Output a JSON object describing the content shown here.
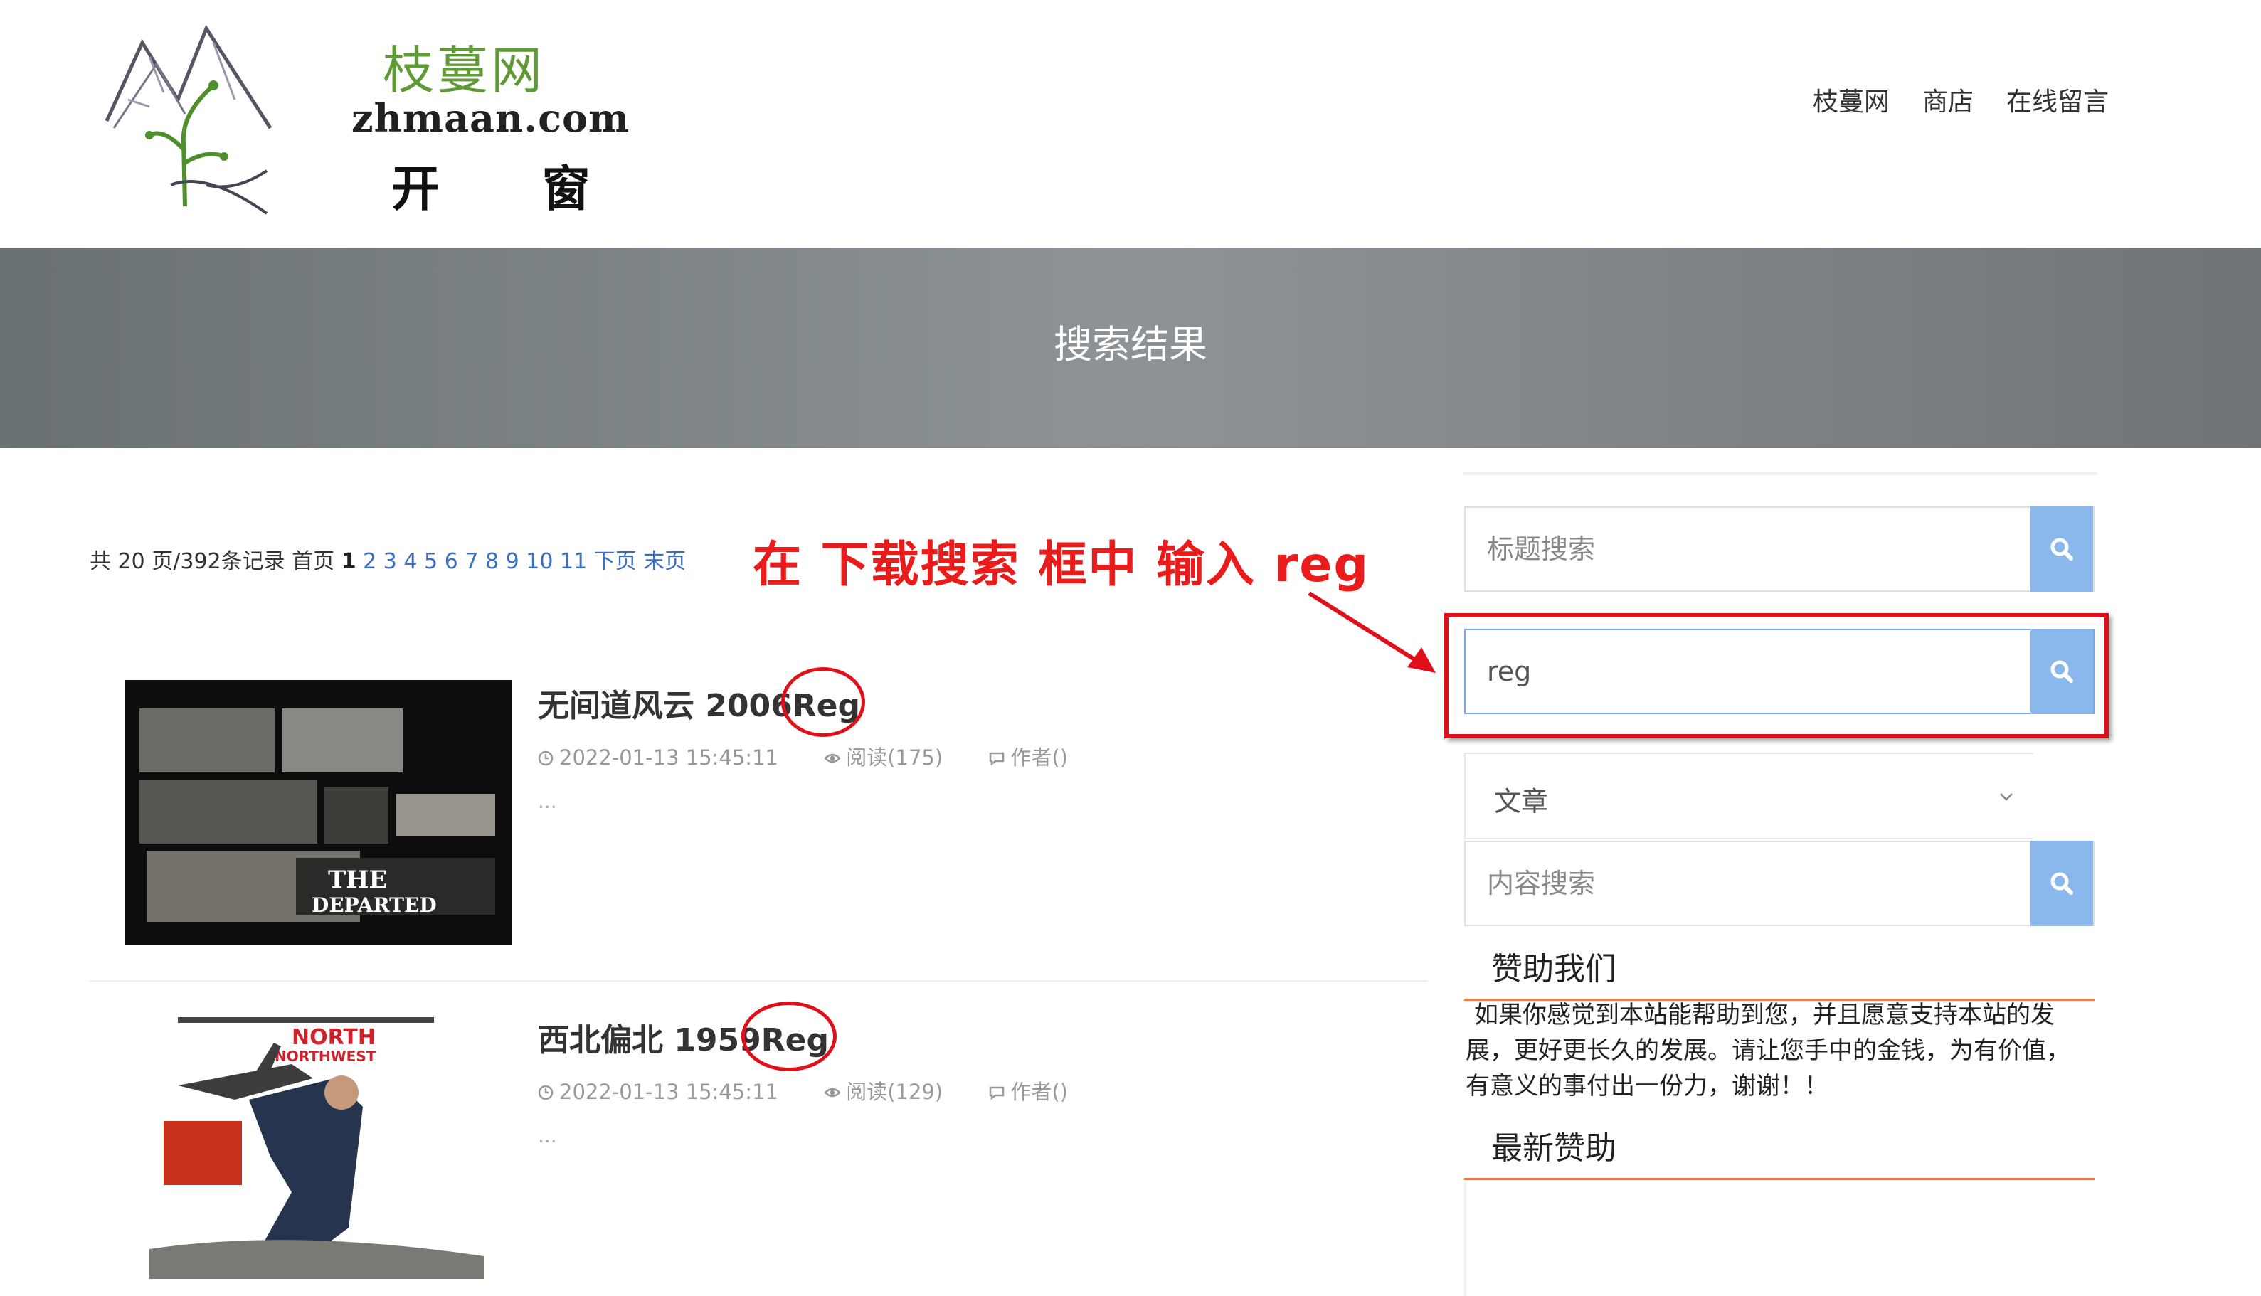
{
  "header": {
    "logo_cn": "枝蔓网",
    "logo_domain": "zhmaan.com",
    "logo_sub": "开 窗",
    "nav": [
      "枝蔓网",
      "商店",
      "在线留言"
    ]
  },
  "banner": {
    "title": "搜索结果"
  },
  "pagination": {
    "summary": "共 20 页/392条记录 首页",
    "current": "1",
    "pages": [
      "2",
      "3",
      "4",
      "5",
      "6",
      "7",
      "8",
      "9",
      "10",
      "11"
    ],
    "next": "下页",
    "last": "末页"
  },
  "results": [
    {
      "title_prefix": "无间道风云 2006",
      "title_highlight": "Reg",
      "date": "2022-01-13 15:45:11",
      "reads": "阅读(175)",
      "author": "作者()",
      "excerpt": "...",
      "thumb_text": "THE DEPARTED"
    },
    {
      "title_prefix": "西北偏北 1959",
      "title_highlight": "Reg",
      "date": "2022-01-13 15:45:11",
      "reads": "阅读(129)",
      "author": "作者()",
      "excerpt": "...",
      "thumb_text": "NORTH BY NORTHWEST"
    }
  ],
  "sidebar": {
    "title_search_placeholder": "标题搜索",
    "download_search_value": "reg",
    "type_select_value": "文章",
    "content_search_placeholder": "内容搜索",
    "sponsor_title": "赞助我们",
    "sponsor_text": "如果你感觉到本站能帮助到您，并且愿意支持本站的发展，更好更长久的发展。请让您手中的金钱，为有价值，有意义的事付出一份力，谢谢！！",
    "latest_title": "最新赞助"
  },
  "annotation": {
    "text": "在 下载搜索 框中 输入 reg"
  },
  "colors": {
    "accent_button": "#8ab8ec",
    "link": "#3a6fc4",
    "annotation_red": "#e0101a",
    "widget_underline": "#f07a4c",
    "logo_green": "#5f9a36"
  }
}
